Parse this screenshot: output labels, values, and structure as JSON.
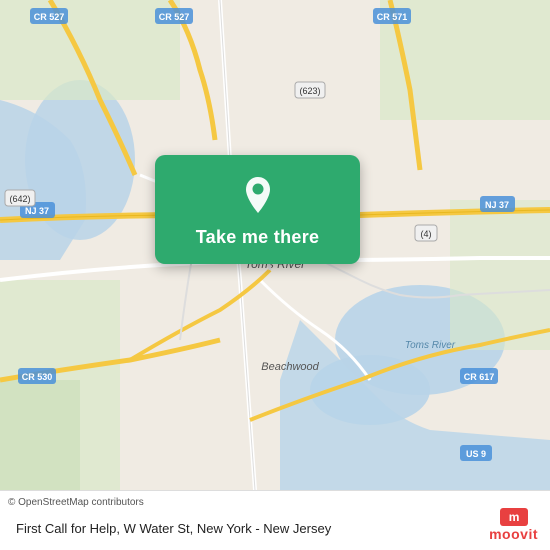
{
  "map": {
    "attribution": "© OpenStreetMap contributors",
    "alt": "Map showing Toms River, New Jersey area with Beachwood"
  },
  "card": {
    "button_label": "Take me there",
    "pin_icon": "location-pin"
  },
  "bottom_bar": {
    "location_text": "First Call for Help, W Water St, New York - New Jersey",
    "logo_text": "moovit"
  }
}
